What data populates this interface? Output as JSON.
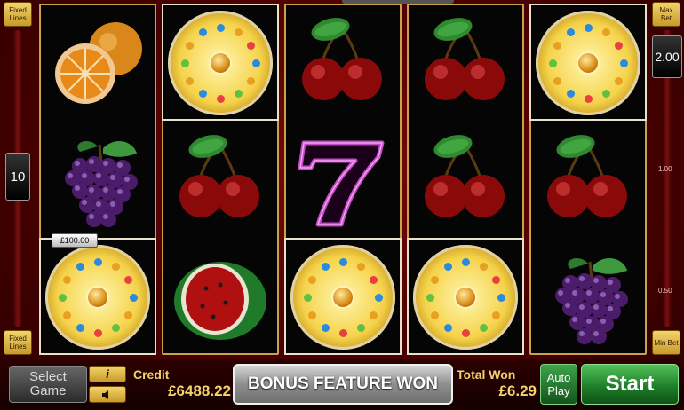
{
  "controls": {
    "fixed_lines_top": "Fixed Lines",
    "fixed_lines_bottom": "Fixed Lines",
    "lines_value": "10",
    "max_bet": "Max Bet",
    "min_bet": "Min Bet",
    "bet_value": "2.00",
    "scale_ticks": [
      "1.00",
      "0.50"
    ]
  },
  "reels": [
    [
      "orange",
      "grapes",
      "wheel"
    ],
    [
      "wheel",
      "cherries",
      "watermelon"
    ],
    [
      "cherries",
      "seven",
      "wheel"
    ],
    [
      "cherries",
      "cherries",
      "wheel"
    ],
    [
      "wheel",
      "cherries",
      "grapes"
    ]
  ],
  "prize_tag": "£100.00",
  "footer": {
    "select_game": "Select Game",
    "info_icon": "i",
    "credit_label": "Credit",
    "credit_value": "£6488.22",
    "message": "BONUS FEATURE WON",
    "total_won_label": "Total Won",
    "total_won_value": "£6.29",
    "auto_play": "Auto Play",
    "start": "Start"
  },
  "colors": {
    "gold": "#f3d36b",
    "background_red": "#7a0a0a",
    "start_green": "#1c7a26"
  }
}
